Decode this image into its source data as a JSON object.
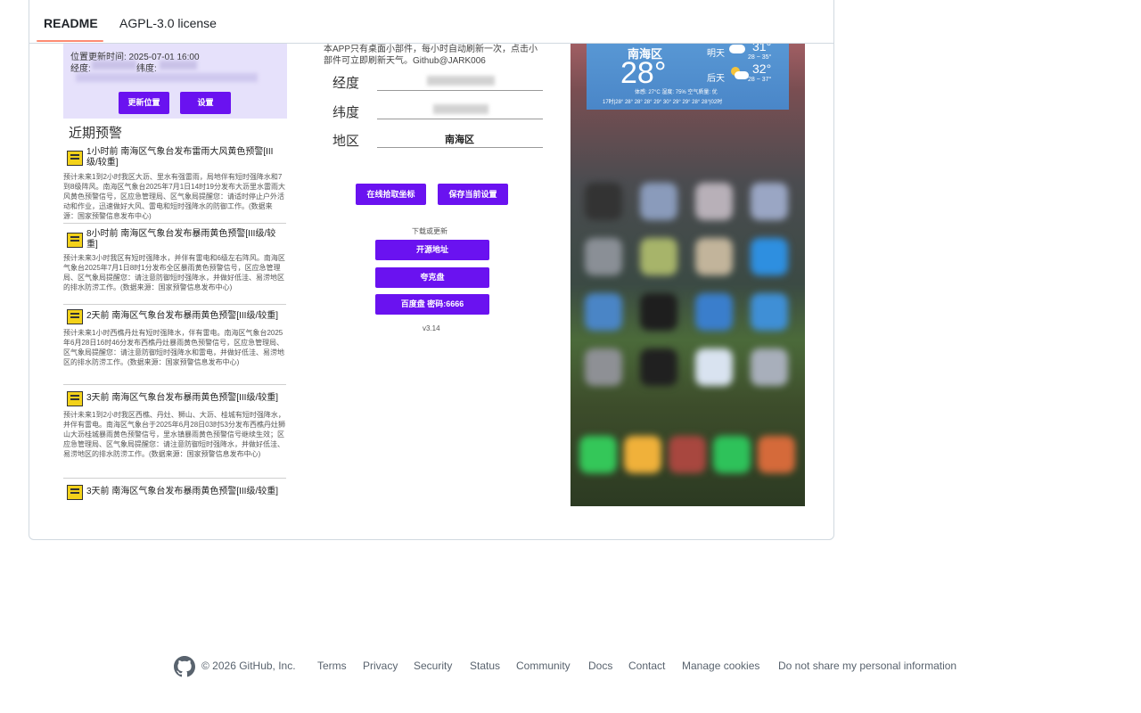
{
  "tabs": [
    {
      "label": "README",
      "active": true
    },
    {
      "label": "AGPL-3.0 license",
      "active": false
    }
  ],
  "shotA": {
    "location_time": "位置更新时间: 2025-07-01 16:00",
    "lng_label": "经度:",
    "lat_label": "纬度:",
    "btn_update": "更新位置",
    "btn_settings": "设置",
    "section_title": "近期预警",
    "warnings": [
      {
        "title": "1小时前 南海区气象台发布雷雨大风黄色预警[III级/较重]",
        "body": "预计未来1到2小时我区大沥、里水有强雷雨，局地伴有短时强降水和7到8级阵风。南海区气象台2025年7月1日14时19分发布大沥里水雷雨大风黄色预警信号，区应急管理局、区气象局提醒您：请适时停止户外活动和作业，迅速做好大风、雷电和短时强降水的防御工作。(数据来源：国家预警信息发布中心)"
      },
      {
        "title": "8小时前 南海区气象台发布暴雨黄色预警[III级/较重]",
        "body": "预计未来3小时我区有短时强降水，并伴有雷电和6级左右阵风。南海区气象台2025年7月1日8时1分发布全区暴雨黄色预警信号，区应急管理局、区气象局提醒您：请注意防御短时强降水，并做好低洼、易涝地区的排水防涝工作。(数据来源：国家预警信息发布中心)"
      },
      {
        "title": "2天前 南海区气象台发布暴雨黄色预警[III级/较重]",
        "body": "预计未来1小时西樵丹灶有短时强降水，伴有雷电。南海区气象台2025年6月28日16时46分发布西樵丹灶暴雨黄色预警信号，区应急管理局、区气象局提醒您：请注意防御短时强降水和雷电，并做好低洼、易涝地区的排水防涝工作。(数据来源：国家预警信息发布中心)"
      },
      {
        "title": "3天前 南海区气象台发布暴雨黄色预警[III级/较重]",
        "body": "预计未来1到2小时我区西樵、丹灶、狮山、大沥、桂城有短时强降水，并伴有雷电。南海区气象台于2025年6月28日03时53分发布西樵丹灶狮山大沥桂城暴雨黄色预警信号，里水镇暴雨黄色预警信号继续生效；区应急管理局、区气象局提醒您：请注意防御短时强降水，并做好低洼、易涝地区的排水防涝工作。(数据来源：国家预警信息发布中心)"
      },
      {
        "title": "3天前 南海区气象台发布暴雨黄色预警[III级/较重]",
        "body": ""
      }
    ]
  },
  "shotB": {
    "intro": "本APP只有桌面小部件，每小时自动刷新一次，点击小部件可立即刷新天气。Github@JARK006",
    "lng_label": "经度",
    "lat_label": "纬度",
    "area_label": "地区",
    "area_value": "南海区",
    "btn_pick": "在线拾取坐标",
    "btn_save": "保存当前设置",
    "download_label": "下载或更新",
    "btn_source": "开源地址",
    "btn_quark": "夸克盘",
    "btn_baidu": "百度盘 密码:6666",
    "version": "v3.14"
  },
  "shotC": {
    "area": "南海区",
    "temp": "28°",
    "tomorrow_label": "明天",
    "tomorrow_temp": "31°",
    "tomorrow_range": "28 ~ 35°",
    "dayafter_label": "后天",
    "dayafter_temp": "32°",
    "dayafter_range": "28 ~ 37°",
    "stats": "体感: 27°C   湿度: 75%   空气质量: 优",
    "hourly": "17时|28°  28°  28°  28°  29°  30°  29°  29°  28°  28°|02时"
  },
  "footer": {
    "copyright": "© 2026 GitHub, Inc.",
    "links": [
      "Terms",
      "Privacy",
      "Security",
      "Status",
      "Community",
      "Docs",
      "Contact",
      "Manage cookies",
      "Do not share my personal information"
    ]
  },
  "colors": {
    "tab_underline": "#fd8c73",
    "app_button": "#6a12f0",
    "widget_blue": "#4a90d0",
    "footer_text": "#59636e"
  }
}
